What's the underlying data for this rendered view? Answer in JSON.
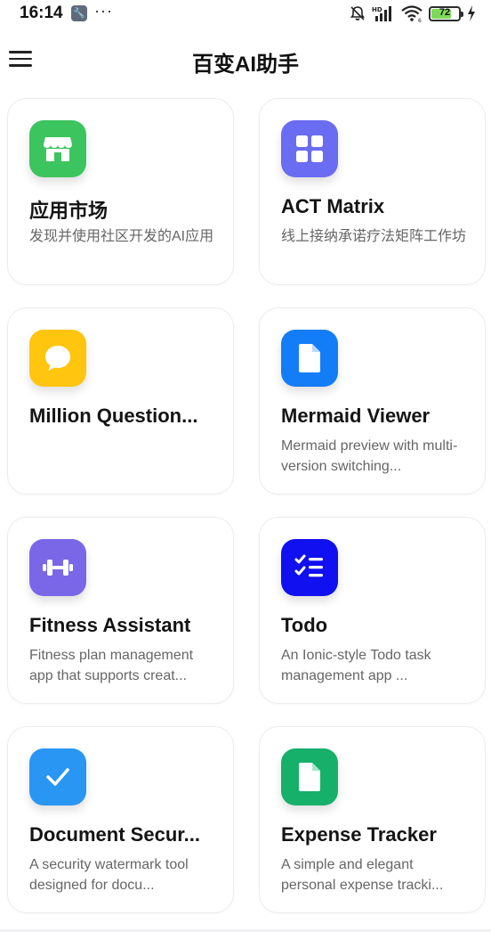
{
  "status_bar": {
    "time": "16:14",
    "app_icon": "wrench-icon",
    "overflow": "···",
    "indicators": [
      "bell-muted-icon",
      "signal-hd-icon",
      "wifi-icon"
    ],
    "battery": "72",
    "battery_level": 0.72,
    "charging_icon": "lightning-icon"
  },
  "header": {
    "menu_icon": "hamburger-menu-icon",
    "title": "百变AI助手"
  },
  "colors": {
    "market": "#3cc45e",
    "act": "#6a6cf2",
    "million": "#ffc50f",
    "mermaid": "#137df7",
    "fitness": "#7a67e8",
    "todo": "#1010f0",
    "document": "#2a96f3",
    "expense": "#16b06b"
  },
  "cards": [
    {
      "title": "应用市场",
      "desc": "发现并使用社区开发的AI应用",
      "icon": "store-icon"
    },
    {
      "title": "ACT Matrix",
      "desc": "线上接纳承诺疗法矩阵工作坊",
      "icon": "grid-icon"
    },
    {
      "title": "Million Question...",
      "desc": "",
      "icon": "chat-bubble-icon"
    },
    {
      "title": "Mermaid Viewer",
      "desc": "Mermaid preview with multi-version switching...",
      "icon": "document-icon"
    },
    {
      "title": "Fitness Assistant",
      "desc": "Fitness plan management app that supports creat...",
      "icon": "dumbbell-icon"
    },
    {
      "title": "Todo",
      "desc": "An Ionic-style Todo task management app ...",
      "icon": "checklist-icon"
    },
    {
      "title": "Document Secur...",
      "desc": "A security watermark tool designed for docu...",
      "icon": "checkmark-icon"
    },
    {
      "title": "Expense Tracker",
      "desc": "A simple and elegant personal expense tracki...",
      "icon": "document-icon"
    }
  ]
}
